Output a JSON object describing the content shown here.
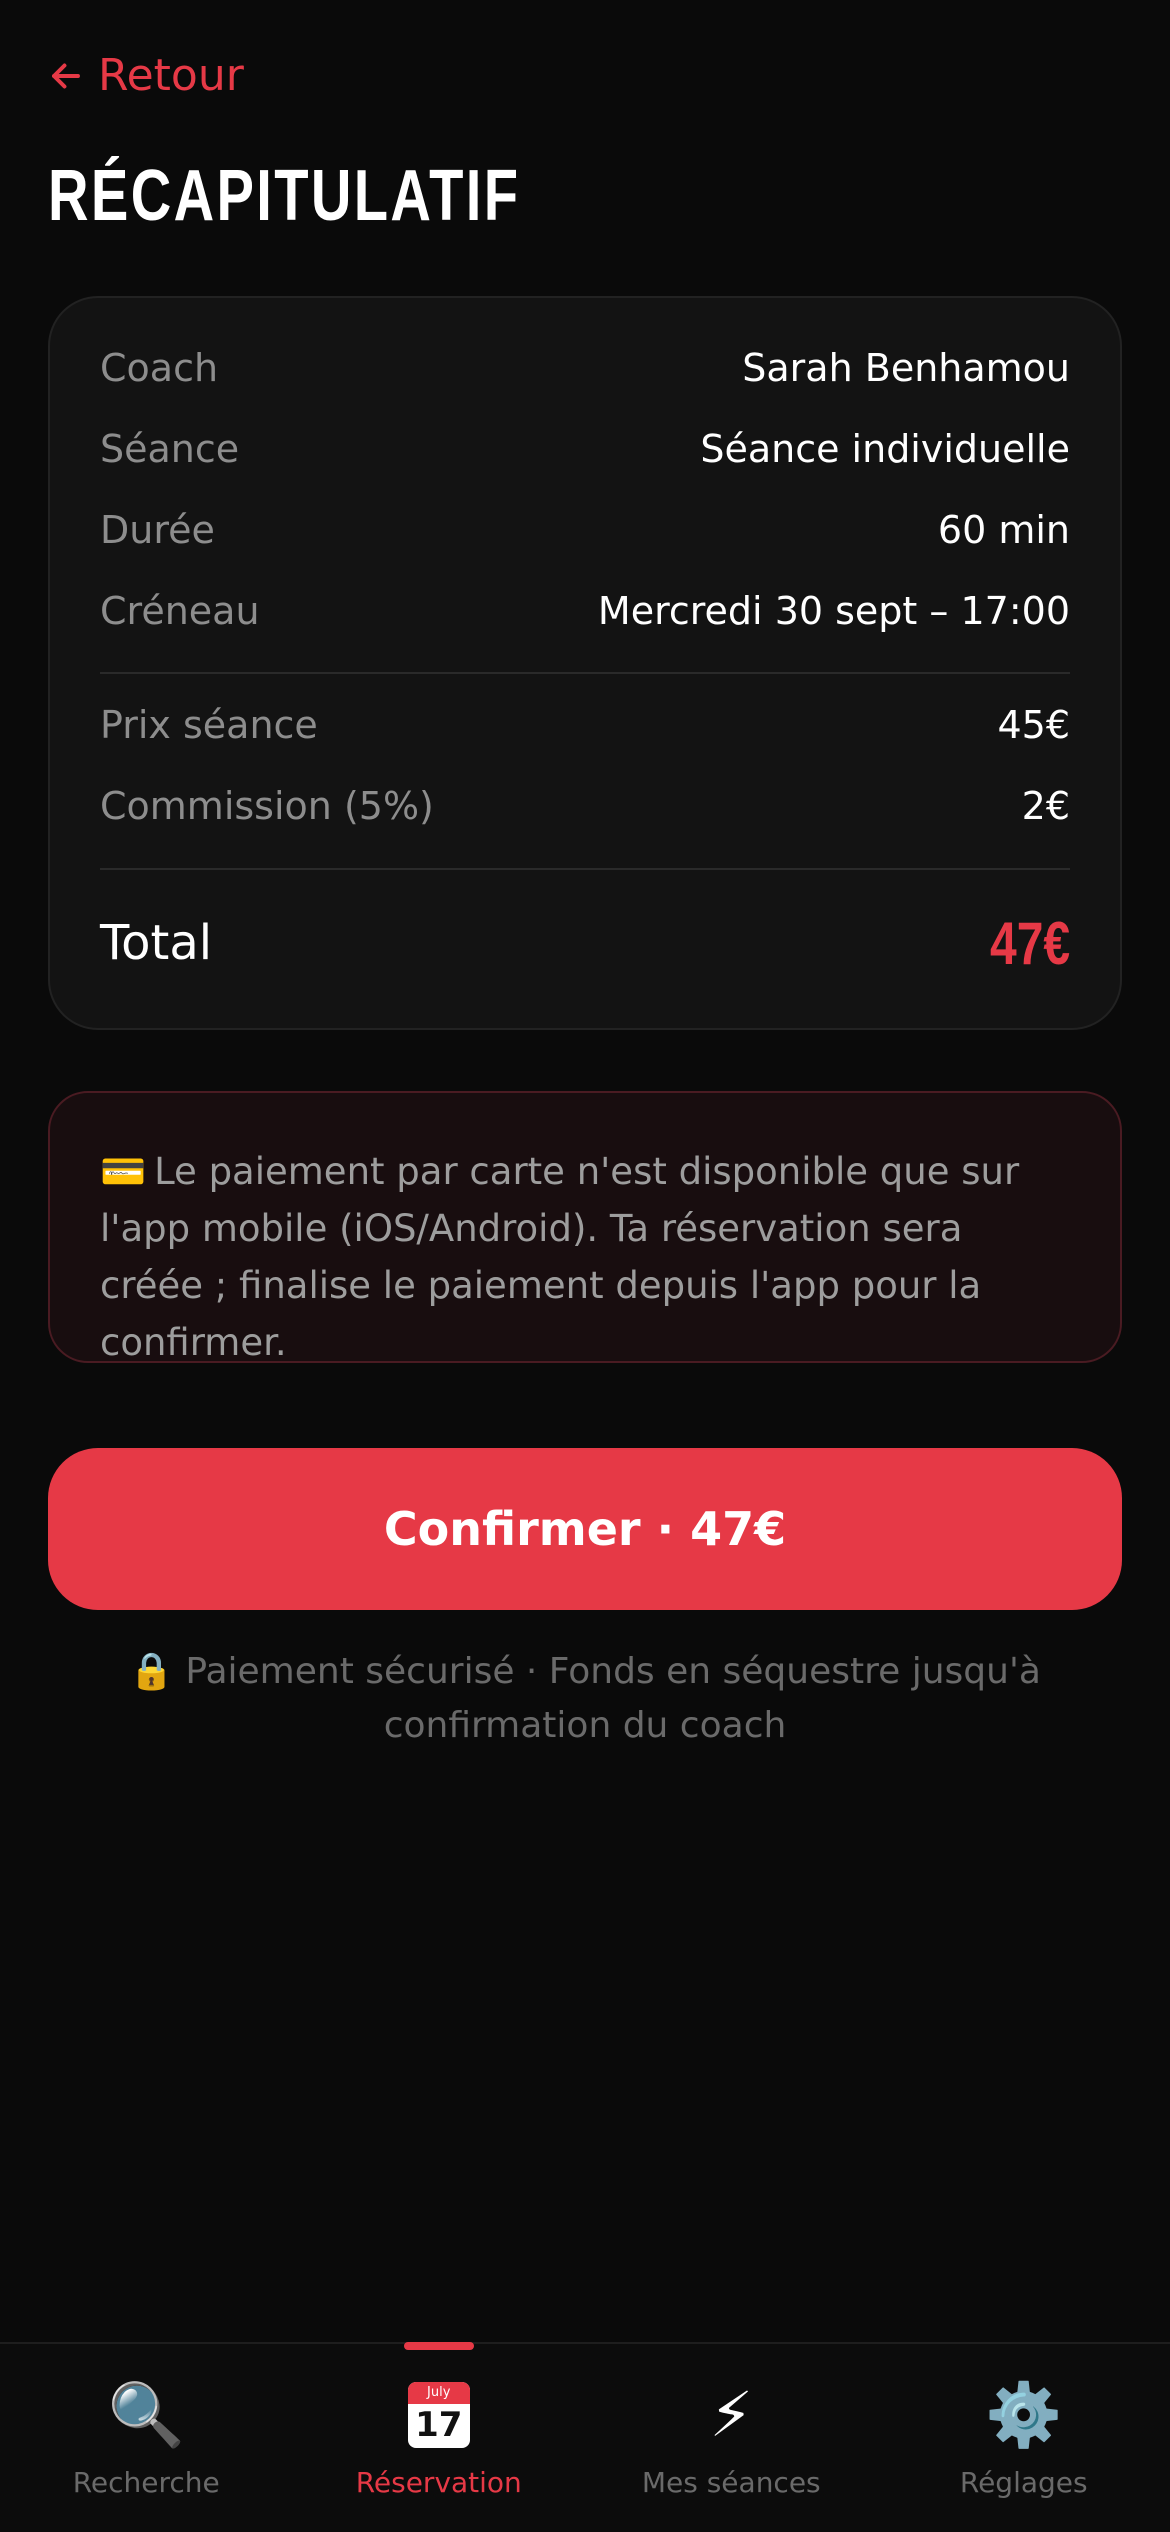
{
  "header": {
    "back_label": "Retour",
    "title": "RÉCAPITULATIF"
  },
  "summary": {
    "coach_label": "Coach",
    "coach_value": "Sarah Benhamou",
    "session_label": "Séance",
    "session_value": "Séance individuelle",
    "duration_label": "Durée",
    "duration_value": "60 min",
    "slot_label": "Créneau",
    "slot_value": "Mercredi 30 sept – 17:00",
    "price_label": "Prix séance",
    "price_value": "45€",
    "commission_label": "Commission (5%)",
    "commission_value": "2€",
    "total_label": "Total",
    "total_value": "47€"
  },
  "notice": {
    "icon": "credit-card-icon",
    "text": "Le paiement par carte n'est disponible que sur l'app mobile (iOS/Android). Ta réservation sera créée ; finalise le paiement depuis l'app pour la confirmer."
  },
  "confirm_button": {
    "label": "Confirmer · 47€"
  },
  "secure_note": {
    "icon": "lock-icon",
    "text": "Paiement sécurisé · Fonds en séquestre jusqu'à confirmation du coach"
  },
  "tab_bar": {
    "tabs": [
      {
        "label": "Recherche",
        "icon": "magnifier-icon"
      },
      {
        "label": "Réservation",
        "icon": "calendar-icon",
        "calendar_month": "July",
        "calendar_day": "17"
      },
      {
        "label": "Mes séances",
        "icon": "lightning-icon"
      },
      {
        "label": "Réglages",
        "icon": "gear-icon"
      }
    ],
    "active_index": 1
  },
  "colors": {
    "accent": "#e63946",
    "background": "#0a0a0a",
    "card": "#131313"
  }
}
